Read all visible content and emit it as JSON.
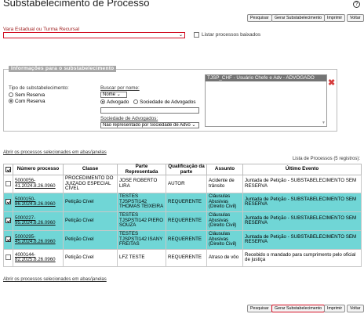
{
  "page": {
    "title": "Substabelecimento de Processo",
    "help_icon": "help-circle-icon"
  },
  "top_buttons": [
    "Pesquisar",
    "Gerar Substabelecimento",
    "Imprimir",
    "Voltar"
  ],
  "bottom_buttons": [
    "Pesquisar",
    "Gerar Substabelecimento",
    "Imprimir",
    "Voltar"
  ],
  "filter": {
    "vara_label": "Vara Estadual ou Turma Recursal",
    "vara_value": "",
    "baixados_label": "Listar processos baixados"
  },
  "info": {
    "legend": "Informações para o substabelecimento",
    "tipo_label": "Tipo de substabelecimento:",
    "sem_reserva": "Sem Reserva",
    "com_reserva": "Com Reserva",
    "buscar_label": "Buscar por nome:",
    "nome_select": "Nome",
    "advogado": "Advogado",
    "sociedade": "Sociedade de Advogados",
    "sociedade_label": "Sociedade de Advogados:",
    "sociedade_select": "Não representado por Sociedade de Advo",
    "selected_user": "TJSP_CHF - Usuário Chefe e Adv - ADVOGADO",
    "remove_icon": "close-icon"
  },
  "links": {
    "open_selected": "Abrir os processos selecionados em abas/janelas"
  },
  "table": {
    "caption": "Lista de Processos (5 registros):",
    "columns": [
      "",
      "Número processo",
      "Classe",
      "Parte Representada",
      "Qualificação da parte",
      "Assunto",
      "Último Evento"
    ],
    "rows": [
      {
        "selected": false,
        "numero": "5000056-41.2024.8.26.0960",
        "classe": "PROCEDIMENTO DO JUIZADO ESPECIAL CÍVEL",
        "parte": "JOSE ROBERTO LIRA",
        "qualificacao": "AUTOR",
        "assunto": "Acidente de trânsito",
        "evento": "Juntada de Petição - SUBSTABELECIMENTO SEM RESERVA"
      },
      {
        "selected": true,
        "numero": "5000150-86.2024.8.26.0960",
        "classe": "Petição Cível",
        "parte": "TESTES TJSPSTI142 THOMAS TEIXEIRA",
        "qualificacao": "REQUERENTE",
        "assunto": "Cláusulas Abusivas (Direito Civil)",
        "evento": "Juntada de Petição - SUBSTABELECIMENTO SEM RESERVA"
      },
      {
        "selected": true,
        "numero": "5000227-95.2024.8.26.0960",
        "classe": "Petição Cível",
        "parte": "TESTES TJSPSTI142 PIERO SOUZA",
        "qualificacao": "REQUERENTE",
        "assunto": "Cláusulas Abusivas (Direito Civil)",
        "evento": "Juntada de Petição - SUBSTABELECIMENTO SEM RESERVA"
      },
      {
        "selected": true,
        "numero": "5000295-45.2024.8.26.0960",
        "classe": "Petição Cível",
        "parte": "TESTES TJSPSTI142 ISANY FREITAS",
        "qualificacao": "REQUERENTE",
        "assunto": "Cláusulas Abusivas (Direito Civil)",
        "evento": "Juntada de Petição - SUBSTABELECIMENTO SEM RESERVA"
      },
      {
        "selected": false,
        "numero": "4000144-82.2025.8.26.0960",
        "classe": "Petição Cível",
        "parte": "LFZ TESTE",
        "qualificacao": "REQUERENTE",
        "assunto": "Atraso de vôo",
        "evento": "Recebido o mandado para cumprimento pelo oficial de justiça"
      }
    ]
  },
  "colors": {
    "selected_row": "#70d6d6",
    "highlight_border": "#d20f23",
    "legend_bg": "#a7a7a7"
  }
}
